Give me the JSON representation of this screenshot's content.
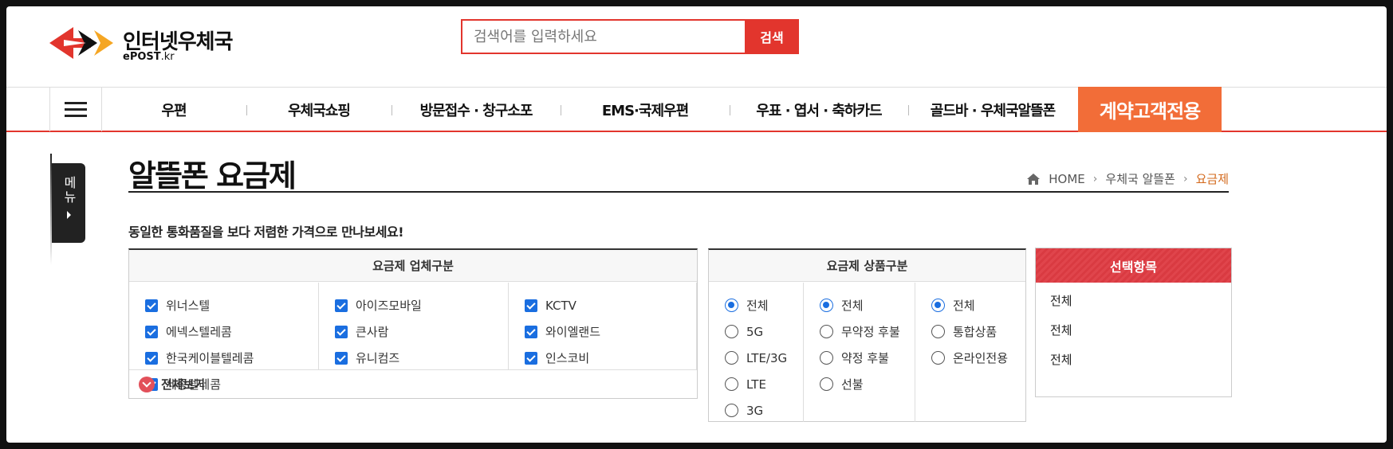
{
  "header": {
    "logo_title": "인터넷우체국",
    "logo_sub_main": "ePOST",
    "logo_sub_kr": ".kr",
    "search_placeholder": "검색어를 입력하세요",
    "search_button": "검색"
  },
  "nav": {
    "items": [
      "우편",
      "우체국쇼핑",
      "방문접수 · 창구소포",
      "EMS·국제우편",
      "우표 · 엽서 · 축하카드",
      "골드바 · 우체국알뜰폰"
    ],
    "special": "계약고객전용"
  },
  "side_menu": {
    "label": "메뉴"
  },
  "page": {
    "title": "알뜰폰 요금제",
    "subtitle": "동일한 통화품질을 보다 저렴한 가격으로 만나보세요!"
  },
  "breadcrumb": {
    "home": "HOME",
    "level1": "우체국 알뜰폰",
    "current": "요금제"
  },
  "carrier_panel": {
    "title": "요금제 업체구분",
    "columns": [
      [
        "위너스텔",
        "에넥스텔레콤",
        "한국케이블텔레콤",
        "세종텔레콤"
      ],
      [
        "아이즈모바일",
        "큰사람",
        "유니컴즈"
      ],
      [
        "KCTV",
        "와이엘랜드",
        "인스코비"
      ]
    ],
    "view_all": "전체보기"
  },
  "product_panel": {
    "title": "요금제 상품구분",
    "columns": [
      [
        "전체",
        "5G",
        "LTE/3G",
        "LTE",
        "3G"
      ],
      [
        "전체",
        "무약정 후불",
        "약정 후불",
        "선불"
      ],
      [
        "전체",
        "통합상품",
        "온라인전용"
      ]
    ]
  },
  "selection_panel": {
    "title": "선택항목",
    "items": [
      "전체",
      "전체",
      "전체"
    ]
  },
  "colors": {
    "brand_red": "#e2352d",
    "special_orange": "#f26d38",
    "check_blue": "#1a6ee0"
  }
}
